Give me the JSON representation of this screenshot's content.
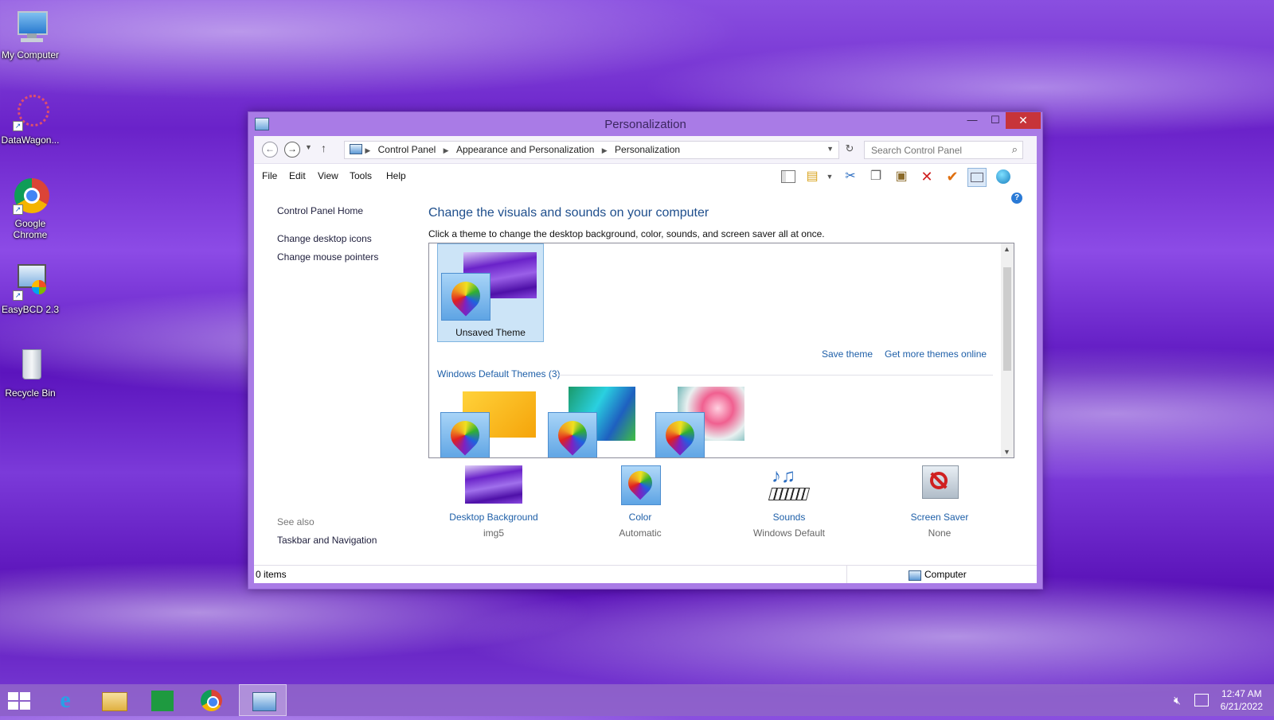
{
  "desktop": {
    "icons": [
      {
        "label": "My Computer"
      },
      {
        "label": "DataWagon..."
      },
      {
        "label": "Google Chrome"
      },
      {
        "label": "EasyBCD 2.3"
      },
      {
        "label": "Recycle Bin"
      }
    ]
  },
  "window": {
    "title": "Personalization",
    "min": "—",
    "max": "☐",
    "close": "✕"
  },
  "address": {
    "crumbs": [
      "Control Panel",
      "Appearance and Personalization",
      "Personalization"
    ],
    "search_placeholder": "Search Control Panel"
  },
  "menu": {
    "file": "File",
    "edit": "Edit",
    "view": "View",
    "tools": "Tools",
    "help": "Help"
  },
  "left_pane": {
    "home": "Control Panel Home",
    "desktop_icons": "Change desktop icons",
    "mouse_pointers": "Change mouse pointers",
    "see_also": "See also",
    "taskbar_nav": "Taskbar and Navigation"
  },
  "content": {
    "headline": "Change the visuals and sounds on your computer",
    "subline": "Click a theme to change the desktop background, color, sounds, and screen saver all at once.",
    "unsaved_theme": "Unsaved Theme",
    "save_theme": "Save theme",
    "get_more": "Get more themes online",
    "default_themes": "Windows Default Themes (3)"
  },
  "bottom": {
    "desktop_background": {
      "label": "Desktop Background",
      "value": "img5"
    },
    "color": {
      "label": "Color",
      "value": "Automatic"
    },
    "sounds": {
      "label": "Sounds",
      "value": "Windows Default"
    },
    "screen_saver": {
      "label": "Screen Saver",
      "value": "None"
    }
  },
  "status": {
    "items": "0 items",
    "location": "Computer"
  },
  "taskbar": {
    "time": "12:47 AM",
    "date": "6/21/2022"
  },
  "colors": {
    "accent": "#a97be6",
    "link": "#1e5fa8",
    "close": "#c7343a"
  }
}
